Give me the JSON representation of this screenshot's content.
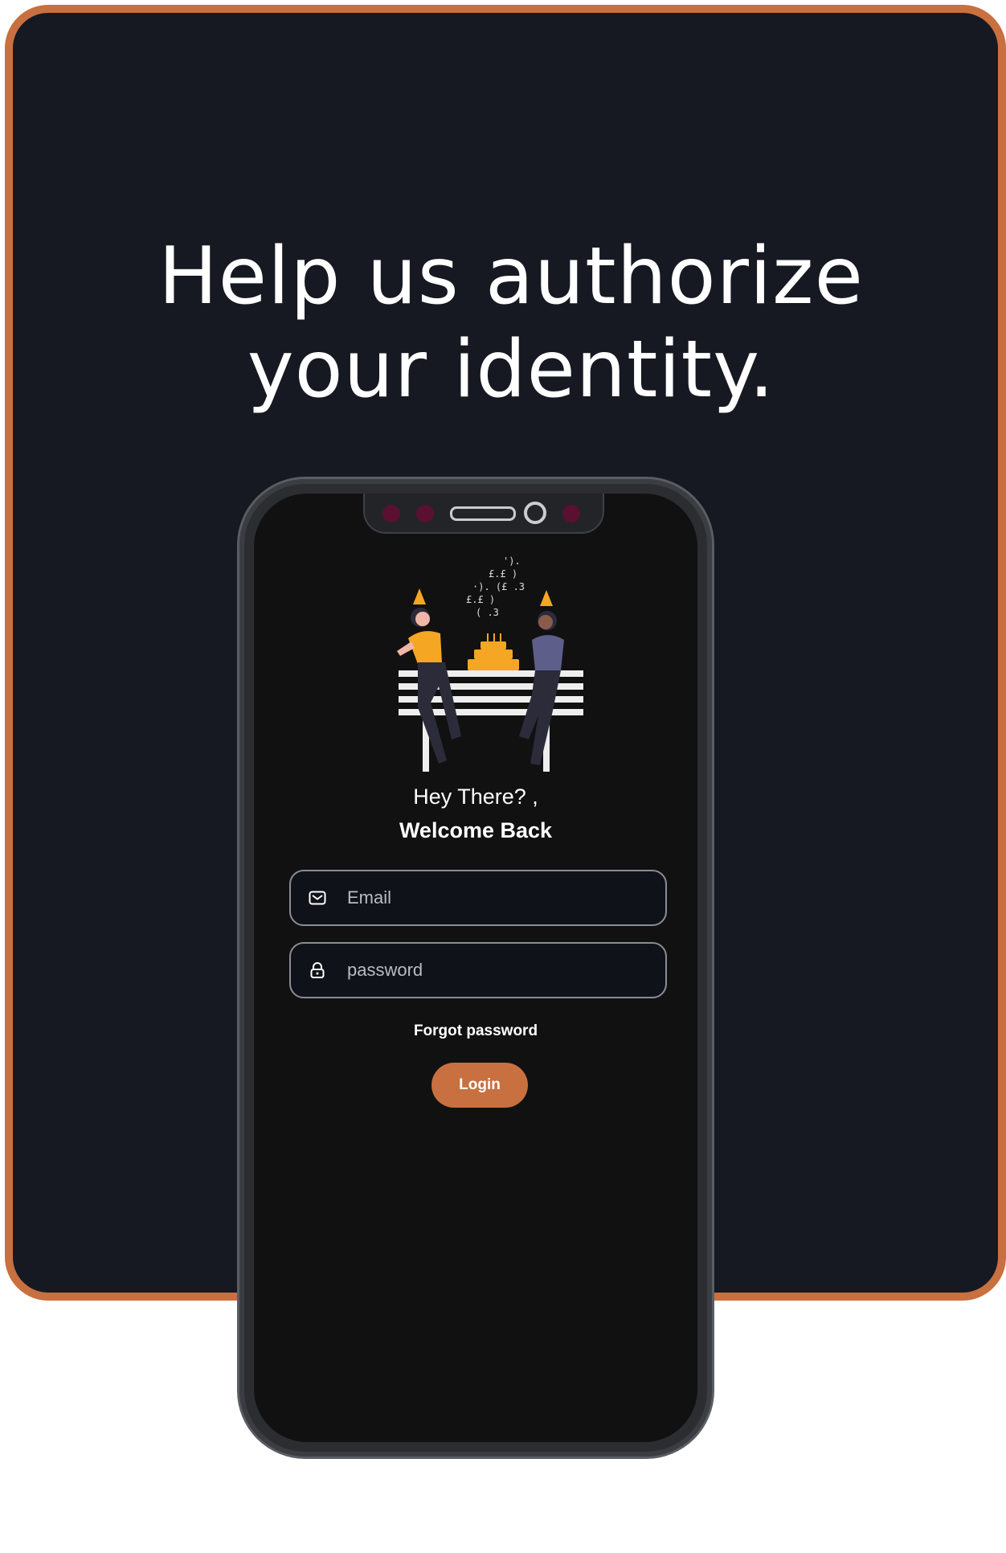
{
  "headline": "Help us authorize your identity.",
  "greeting": {
    "line1": "Hey There? ,",
    "line2": "Welcome Back"
  },
  "form": {
    "email_placeholder": "Email",
    "password_placeholder": "password",
    "forgot_label": "Forgot password",
    "login_label": "Login"
  },
  "icons": {
    "email": "envelope-icon",
    "password": "lock-icon"
  },
  "colors": {
    "accent": "#c8703f",
    "card_background": "#161922",
    "screen_background": "#111111"
  }
}
